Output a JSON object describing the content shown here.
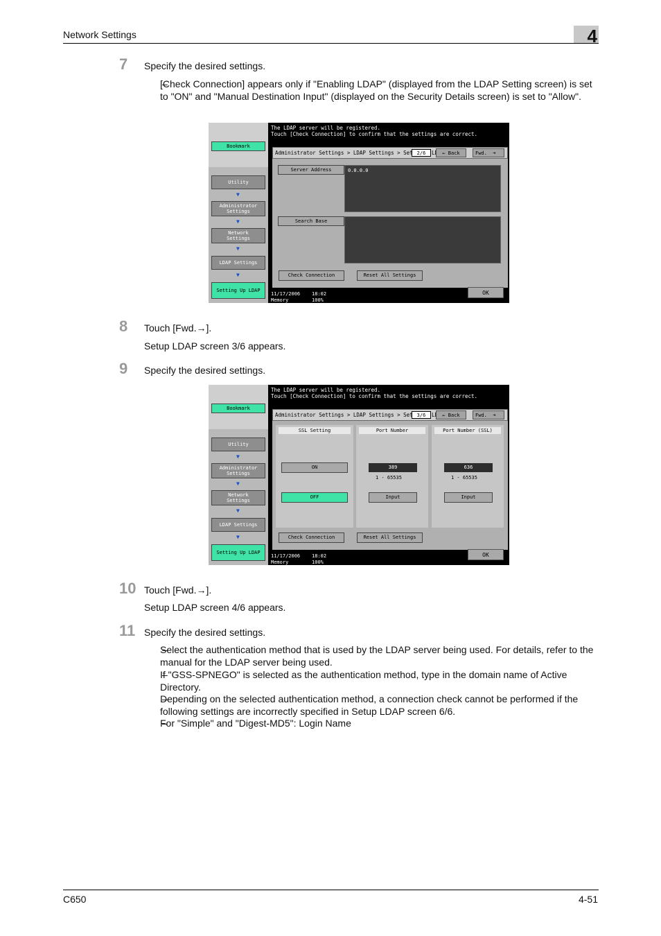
{
  "header": {
    "title": "Network Settings",
    "chapter": "4"
  },
  "footer": {
    "model": "C650",
    "page": "4-51"
  },
  "steps": {
    "s7": {
      "num": "7",
      "text": "Specify the desired settings.",
      "bullet": "[Check Connection] appears only if \"Enabling LDAP\" (displayed from the LDAP Setting screen) is set to \"ON\" and \"Manual Destination Input\" (displayed on the Security Details screen) is set to \"Allow\"."
    },
    "s8": {
      "num": "8",
      "text": "Touch [Fwd.→].",
      "sub": "Setup LDAP screen 3/6 appears."
    },
    "s9": {
      "num": "9",
      "text": "Specify the desired settings."
    },
    "s10": {
      "num": "10",
      "text": "Touch [Fwd.→].",
      "sub": "Setup LDAP screen 4/6 appears."
    },
    "s11": {
      "num": "11",
      "text": "Specify the desired settings.",
      "bullets": [
        "Select the authentication method that is used by the LDAP server being used. For details, refer to the manual for the LDAP server being used.",
        "If \"GSS-SPNEGO\" is selected as the authentication method, type in the domain name of Active Directory.",
        "Depending on the selected authentication method, a connection check cannot be performed if the following settings are incorrectly specified in Setup LDAP screen 6/6.",
        "For \"Simple\" and \"Digest-MD5\": Login Name"
      ]
    }
  },
  "dash": "–",
  "screen": {
    "message_line1": "The LDAP server will be registered.",
    "message_line2": "Touch [Check Connection] to confirm that the settings are correct.",
    "breadcrumb": "Administrator Settings > LDAP Settings > Sett",
    "crumb_tail": "LD",
    "back": "Back",
    "fwd": "Fwd.",
    "sidebar": {
      "bookmark": "Bookmark",
      "utility": "Utility",
      "admin": "Administrator\nSettings",
      "network": "Network\nSettings",
      "ldap": "LDAP Settings",
      "setup": "Setting Up LDAP"
    },
    "check_connection": "Check Connection",
    "reset_all": "Reset All Settings",
    "date": "11/17/2006",
    "time": "18:02",
    "memory_label": "Memory",
    "memory_value": "100%",
    "ok": "OK"
  },
  "screen1": {
    "page": "2/6",
    "server_address_label": "Server Address",
    "server_address_value": "0.0.0.0",
    "search_base_label": "Search Base"
  },
  "screen2": {
    "page": "3/6",
    "ssl_label": "SSL Setting",
    "on": "ON",
    "off": "OFF",
    "port_label": "Port Number",
    "port_value": "389",
    "port_ssl_label": "Port Number (SSL)",
    "port_ssl_value": "636",
    "range": "1  -  65535",
    "input": "Input"
  }
}
